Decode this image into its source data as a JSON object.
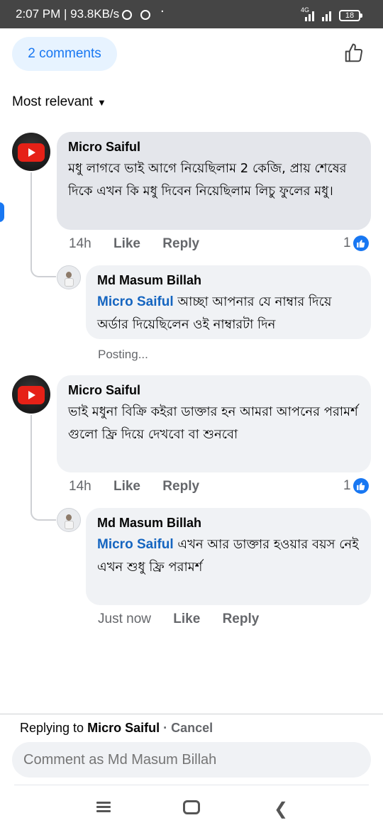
{
  "status_bar": {
    "time": "2:07 PM | 93.8KB/s",
    "network": "4G",
    "battery": "18"
  },
  "header": {
    "comments_count_label": "2 comments",
    "like_icon": "thumbs-up-outline-icon",
    "sort_label": "Most relevant"
  },
  "comments": [
    {
      "author": "Micro Saiful",
      "text": "মধু লাগবে ভাই আগে নিয়েছিলাম 2 কেজি, প্রায় শেষের দিকে এখন কি মধু দিবেন নিয়েছিলাম লিচু ফুলের মধু।",
      "time": "14h",
      "like": "Like",
      "reply": "Reply",
      "reactions": "1",
      "reply_item": {
        "author": "Md Masum Billah",
        "mention": "Micro Saiful",
        "text": "আচ্ছা আপনার যে নাম্বার দিয়ে অর্ডার দিয়েছিলেন ওই নাম্বারটা দিন",
        "status": "Posting..."
      }
    },
    {
      "author": "Micro Saiful",
      "text": "ভাই মধুনা বিক্রি কইরা ডাক্তার হন আমরা আপনের পরামর্শ গুলো ফ্রি দিয়ে দেখবো বা শুনবো",
      "time": "14h",
      "like": "Like",
      "reply": "Reply",
      "reactions": "1",
      "reply_item": {
        "author": "Md Masum Billah",
        "mention": "Micro Saiful",
        "text": "এখন আর ডাক্তার হওয়ার বয়স নেই",
        "text2": "এখন শুধু ফ্রি পরামর্শ",
        "time": "Just now",
        "like": "Like",
        "reply": "Reply"
      }
    }
  ],
  "composer": {
    "replying_prefix": "Replying to",
    "replying_name": "Micro Saiful",
    "cancel": "Cancel",
    "placeholder": "Comment as Md Masum Billah"
  },
  "colors": {
    "accent": "#1877f2",
    "mention": "#1565c0",
    "bubble": "#f0f2f5",
    "bubble_selected": "#e4e6eb",
    "meta_text": "#65676b"
  }
}
